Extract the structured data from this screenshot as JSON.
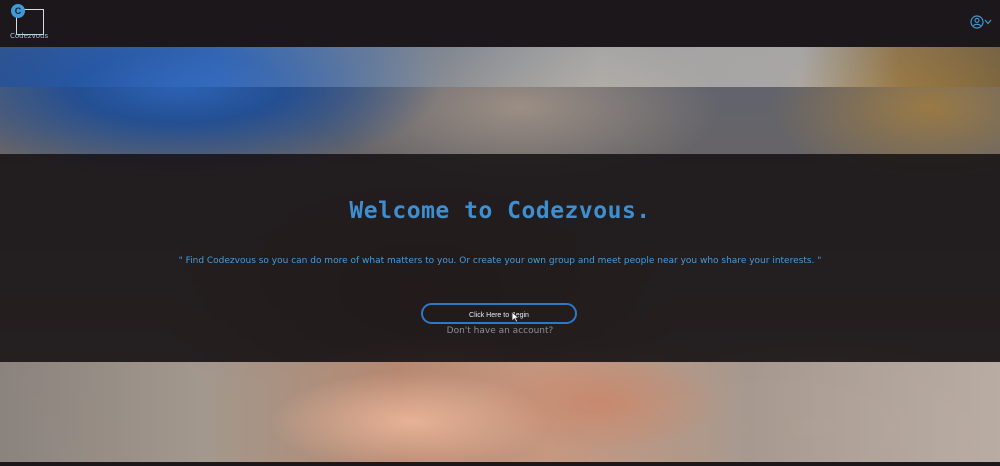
{
  "navbar": {
    "logo_letter": "C",
    "logo_text": "Codezvous",
    "user_icon": "user-circle-icon",
    "dropdown_icon": "chevron-down-icon"
  },
  "hero": {
    "title": "Welcome to Codezvous.",
    "subtitle": "\" Find Codezvous so you can do more of what matters to you. Or create your own group and meet people near you who share your interests. \"",
    "cta_label": "Click Here to Begin",
    "signup_link": "Don't have an account?"
  },
  "colors": {
    "accent": "#3d8fd2",
    "navbar_bg": "#1c171b",
    "button_border": "#2e78c4"
  }
}
